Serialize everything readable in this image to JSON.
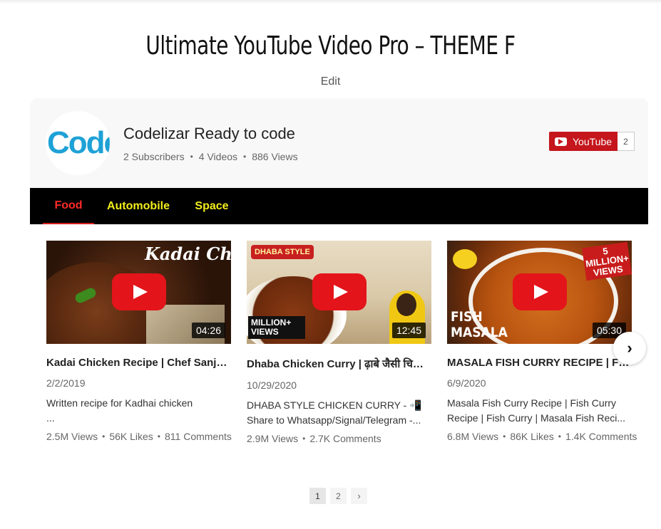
{
  "page": {
    "title": "Ultimate YouTube Video Pro – THEME F",
    "edit_label": "Edit"
  },
  "channel": {
    "avatar_text": "Code",
    "name": "Codelizar Ready to code",
    "subscribers": "2 Subscribers",
    "videos": "4 Videos",
    "views": "886 Views",
    "subscribe_label": "YouTube",
    "subscribe_count": "2"
  },
  "tabs": [
    {
      "label": "Food",
      "active": true
    },
    {
      "label": "Automobile",
      "active": false
    },
    {
      "label": "Space",
      "active": false
    }
  ],
  "videos": [
    {
      "thumb_overlay": "Kadai Chicken",
      "duration": "04:26",
      "title": "Kadai Chicken Recipe | Chef Sanjyot Keer",
      "date": "2/2/2019",
      "desc_line1": "Written recipe for Kadhai chicken",
      "desc_line2": "...",
      "views": "2.5M Views",
      "likes": "56K Likes",
      "comments": "811 Comments"
    },
    {
      "thumb_overlay": "DHABA STYLE",
      "thumb_overlay2": "MILLION+ VIEWS",
      "duration": "12:45",
      "title": "Dhaba Chicken Curry | ढ़ाबे जैसी चिकन करी",
      "date": "10/29/2020",
      "desc_line1": "DHABA STYLE CHICKEN CURRY - 📲",
      "desc_line2": "Share to Whatsapp/Signal/Telegram -...",
      "views": "2.9M Views",
      "comments": "2.7K Comments"
    },
    {
      "thumb_overlay": "FISH MASALA",
      "thumb_overlay2": "5 MILLION+ VIEWS",
      "duration": "05:30",
      "title": "MASALA FISH CURRY RECIPE | FISH CURRY",
      "date": "6/9/2020",
      "desc_line1": "Masala Fish Curry Recipe | Fish Curry",
      "desc_line2": "Recipe | Fish Curry | Masala Fish Reci...",
      "views": "6.8M Views",
      "likes": "86K Likes",
      "comments": "1.4K Comments"
    }
  ],
  "pagination": {
    "pages": [
      "1",
      "2"
    ],
    "current": "1",
    "next_icon": "chevron-right-icon"
  },
  "colors": {
    "accent_red": "#e4141b",
    "tab_active": "#ff2a2a",
    "tab_inactive": "#f2ee1c",
    "tabbar_bg": "#000000"
  }
}
